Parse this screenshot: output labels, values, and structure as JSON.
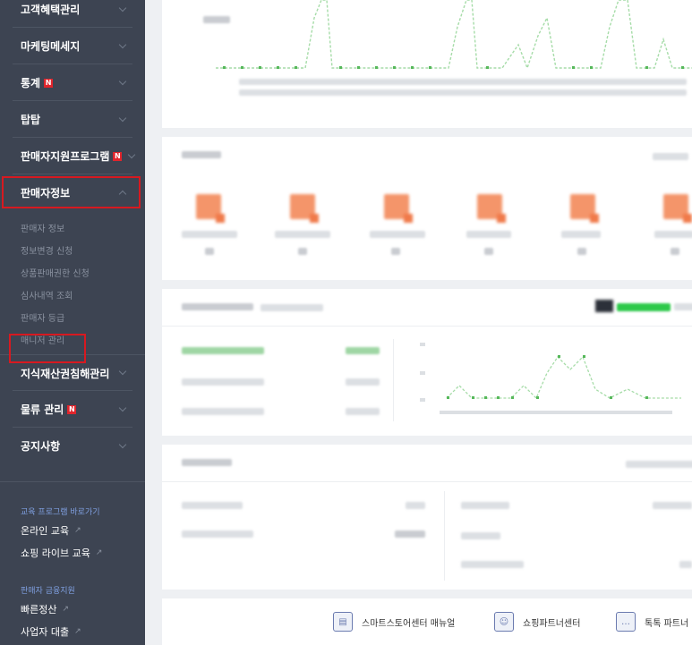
{
  "sidebar": {
    "menu_top": [
      {
        "label": "고객혜택관리",
        "badge": ""
      },
      {
        "label": "마케팅메세지",
        "badge": ""
      },
      {
        "label": "통계",
        "badge": "N"
      },
      {
        "label": "탑탑",
        "badge": ""
      },
      {
        "label": "판매자지원프로그램",
        "badge": "N"
      },
      {
        "label": "판매자정보",
        "badge": ""
      }
    ],
    "sub_items": [
      "판매자 정보",
      "정보변경 신청",
      "상품판매권한 신청",
      "심사내역 조회",
      "판매자 등급",
      "매니저 관리"
    ],
    "menu_bottom": [
      {
        "label": "지식재산권침해관리",
        "badge": ""
      },
      {
        "label": "물류 관리",
        "badge": "N"
      },
      {
        "label": "공지사항",
        "badge": ""
      }
    ],
    "edu_heading": "교육 프로그램 바로가기",
    "edu_links": [
      "온라인 교육",
      "쇼핑 라이브 교육"
    ],
    "finance_heading": "판매자 금융지원",
    "finance_links": [
      "빠른정산",
      "사업자 대출"
    ],
    "badge_color": "#e0252c",
    "highlight_color": "#d71920"
  },
  "footer": {
    "links": [
      "스마트스토어센터 매뉴얼",
      "쇼핑파트너센터",
      "톡톡 파트너"
    ]
  },
  "colors": {
    "sidebar_bg": "#3d4452",
    "chart_green": "#6cc26f",
    "accent_orange": "#f4956a"
  }
}
